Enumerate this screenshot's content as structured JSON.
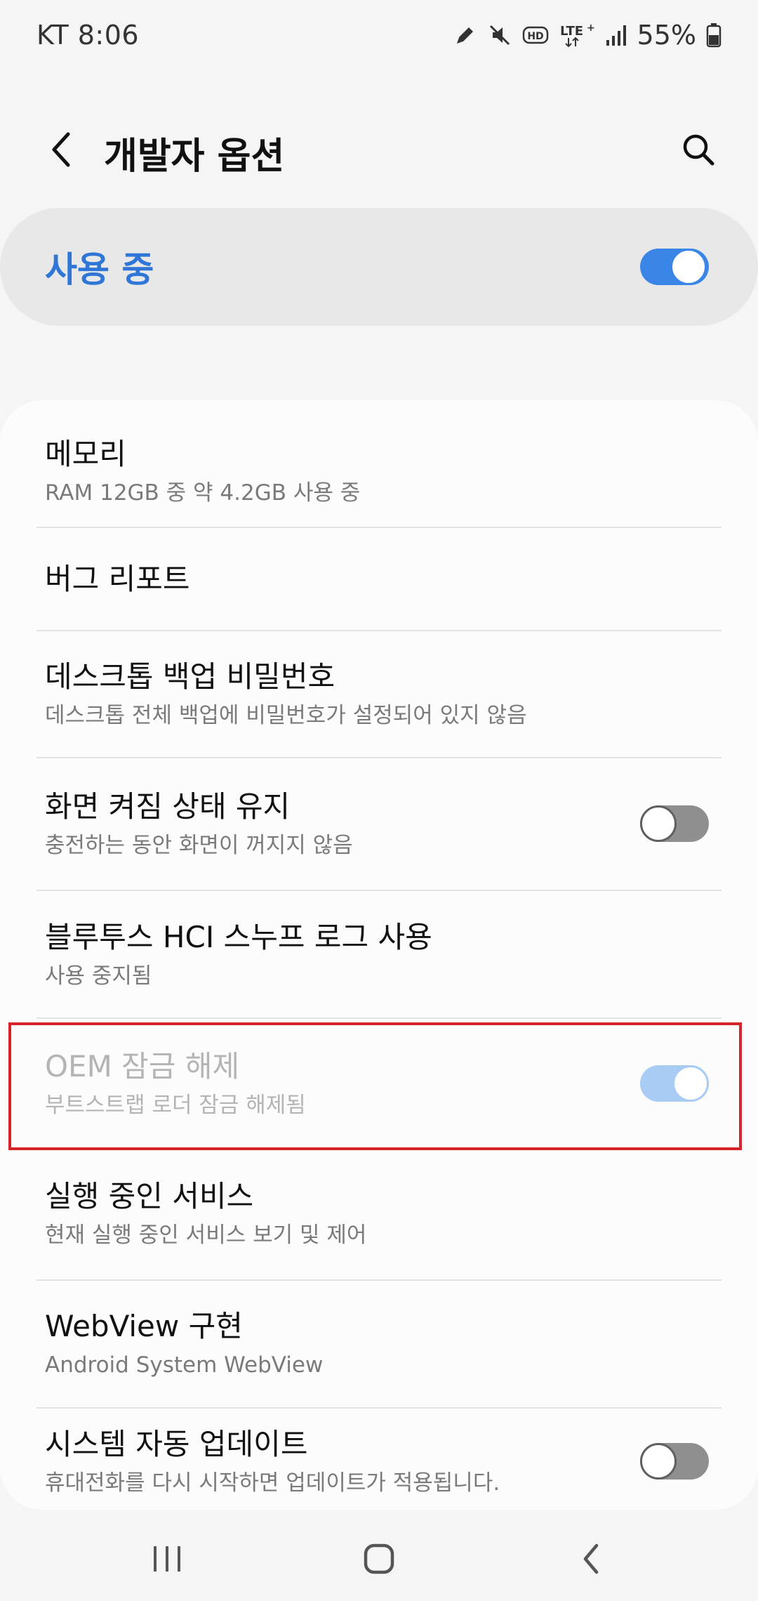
{
  "status_bar": {
    "carrier_time": "KT 8:06",
    "battery_percent": "55%",
    "icons": [
      "pen-icon",
      "mute-icon",
      "hd-icon",
      "lte-icon",
      "signal-icon",
      "battery-icon"
    ]
  },
  "header": {
    "title": "개발자 옵션"
  },
  "master_switch": {
    "label": "사용 중",
    "state": "on",
    "accent_color": "#2f76d6"
  },
  "items": [
    {
      "title": "메모리",
      "subtitle": "RAM 12GB 중 약 4.2GB 사용 중",
      "toggle": null
    },
    {
      "title": "버그 리포트",
      "subtitle": "",
      "toggle": null
    },
    {
      "title": "데스크톱 백업 비밀번호",
      "subtitle": "데스크톱 전체 백업에 비밀번호가 설정되어 있지 않음",
      "toggle": null
    },
    {
      "title": "화면 켜짐 상태 유지",
      "subtitle": "충전하는 동안 화면이 꺼지지 않음",
      "toggle": "off"
    },
    {
      "title": "블루투스 HCI 스누프 로그 사용",
      "subtitle": "사용 중지됨",
      "toggle": null
    },
    {
      "title": "OEM 잠금 해제",
      "subtitle": "부트스트랩 로더 잠금 해제됨",
      "toggle": "on",
      "disabled": true,
      "highlighted": true
    },
    {
      "title": "실행 중인 서비스",
      "subtitle": "현재 실행 중인 서비스 보기 및 제어",
      "toggle": null
    },
    {
      "title": "WebView 구현",
      "subtitle": "Android System WebView",
      "toggle": null
    },
    {
      "title": "시스템 자동 업데이트",
      "subtitle": "휴대전화를 다시 시작하면 업데이트가 적용됩니다.",
      "toggle": "off"
    }
  ],
  "colors": {
    "highlight_border": "#d6252a",
    "toggle_on": "#3a86e6",
    "toggle_off": "#8f8f8f"
  }
}
